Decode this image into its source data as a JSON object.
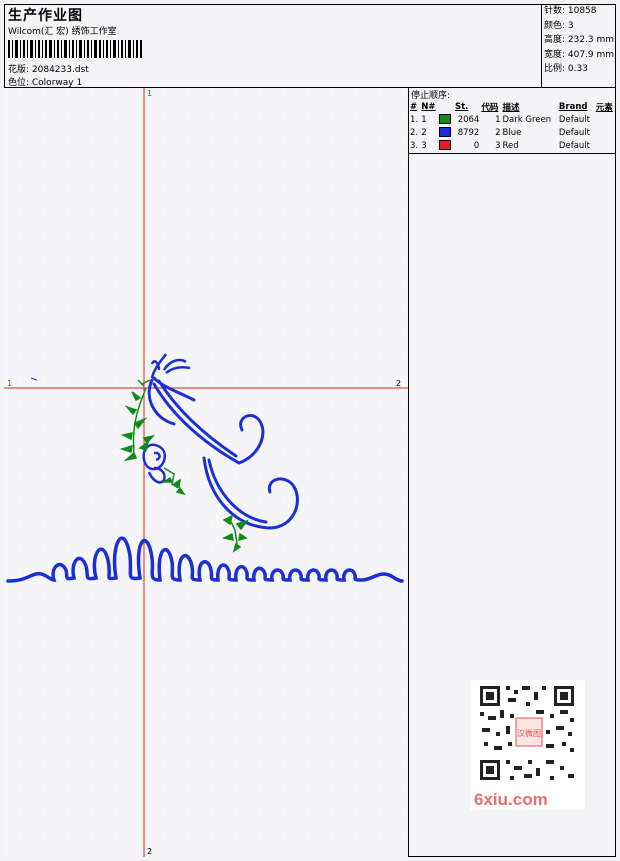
{
  "header": {
    "title": "生产作业图",
    "subtitle": "Wilcom(汇 宏) 绣饰工作室",
    "design_label": "花版: 2084233.dst",
    "colorway_label": "色位:  Colorway 1"
  },
  "stats": {
    "stitches": "针数: 10858",
    "colors": "颜色: 3",
    "height": "高度: 232.3 mm",
    "width": "宽度: 407.9 mm",
    "scale": "比例: 0.33"
  },
  "stop_sequence": {
    "heading": "停止顺序:",
    "columns": [
      "#",
      "N#",
      "St.",
      "代码",
      "描述",
      "Brand",
      "元素"
    ],
    "rows": [
      {
        "idx": "1.",
        "n": "1",
        "color": "#118c1a",
        "st": "2064",
        "code": "1",
        "desc": "Dark Green",
        "brand": "Default"
      },
      {
        "idx": "2.",
        "n": "2",
        "color": "#1a2fd6",
        "st": "8792",
        "code": "2",
        "desc": "Blue",
        "brand": "Default"
      },
      {
        "idx": "3.",
        "n": "3",
        "color": "#e02020",
        "st": "0",
        "code": "3",
        "desc": "Red",
        "brand": "Default"
      }
    ]
  },
  "axes": {
    "x_start": "1",
    "x_end": "2",
    "y_start": "1",
    "y_end": "2"
  },
  "colors": {
    "blue": "#1a2fd6",
    "green": "#118c1a",
    "axis_red": "#e02020"
  },
  "watermark": "6xiu.com",
  "qr_stamp": "汉微图"
}
